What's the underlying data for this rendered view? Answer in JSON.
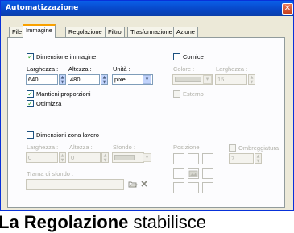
{
  "window": {
    "title": "Automatizzazione",
    "close_glyph": "✕"
  },
  "tabs": [
    {
      "label": "File"
    },
    {
      "label": "Immagine"
    },
    {
      "label": "Regolazione"
    },
    {
      "label": "Filtro"
    },
    {
      "label": "Trasformazione"
    },
    {
      "label": "Azione"
    }
  ],
  "image_size": {
    "checkbox_label": "Dimensione immagine",
    "checked": true,
    "width_label": "Larghezza :",
    "width_value": "640",
    "height_label": "Altezza :",
    "height_value": "480",
    "unit_label": "Unità :",
    "unit_value": "pixel",
    "keep_proportions_label": "Mantieni proporzioni",
    "keep_proportions_checked": true,
    "optimize_label": "Ottimizza",
    "optimize_checked": true
  },
  "frame": {
    "checkbox_label": "Cornice",
    "checked": false,
    "color_label": "Colore :",
    "width_label": "Larghezza :",
    "width_value": "15",
    "outer_label": "Esterno",
    "outer_checked": false
  },
  "workspace": {
    "checkbox_label": "Dimensioni zona lavoro",
    "checked": false,
    "width_label": "Larghezza :",
    "width_value": "0",
    "height_label": "Altezza :",
    "height_value": "0",
    "background_label": "Sfondo :",
    "position_label": "Posizione",
    "shadow_label": "Ombreggiatura",
    "shadow_checked": false,
    "shadow_value": "7",
    "bg_texture_label": "Trama di sfondo :"
  },
  "caption": {
    "bold": "La Regolazione",
    "rest": " stabilisce"
  },
  "colors": {
    "title_bar": "#0746c6",
    "active_tab_accent": "#f9a100",
    "checkmark": "#21a121"
  }
}
